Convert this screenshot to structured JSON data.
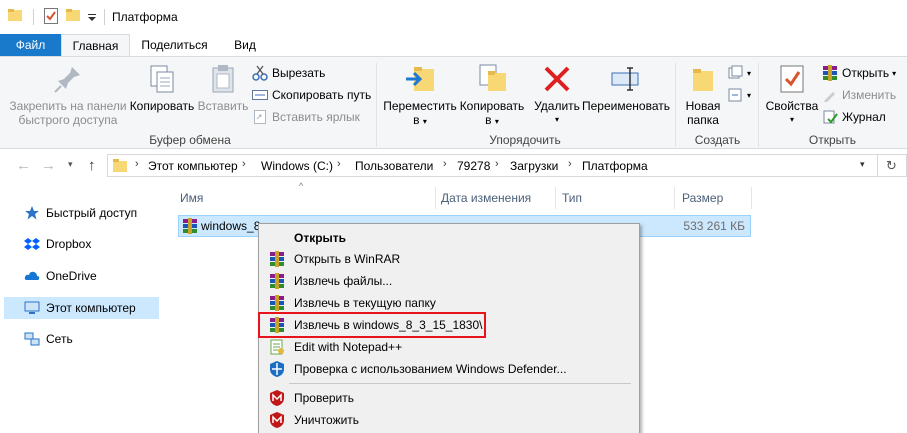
{
  "window": {
    "title": "Платформа"
  },
  "tabs": {
    "file": "Файл",
    "home": "Главная",
    "share": "Поделиться",
    "view": "Вид"
  },
  "ribbon": {
    "clipboard": {
      "pin": "Закрепить на панели быстрого доступа",
      "pin_line1": "Закрепить на панели",
      "pin_line2": "быстрого доступа",
      "copy": "Копировать",
      "paste": "Вставить",
      "cut": "Вырезать",
      "copy_path": "Скопировать путь",
      "paste_shortcut": "Вставить ярлык",
      "label": "Буфер обмена"
    },
    "organize": {
      "move_line1": "Переместить",
      "move_line2": "в",
      "copy_line1": "Копировать",
      "copy_line2": "в",
      "delete": "Удалить",
      "rename": "Переименовать",
      "label": "Упорядочить"
    },
    "new": {
      "folder_line1": "Новая",
      "folder_line2": "папка",
      "label": "Создать"
    },
    "open": {
      "properties": "Свойства",
      "open": "Открыть",
      "edit": "Изменить",
      "history": "Журнал",
      "label": "Открыть"
    }
  },
  "address": {
    "crumbs": [
      "Этот компьютер",
      "Windows (C:)",
      "Пользователи",
      "79278",
      "Загрузки",
      "Платформа"
    ]
  },
  "navpane": {
    "items": [
      {
        "label": "Быстрый доступ",
        "icon": "star-icon"
      },
      {
        "label": "Dropbox",
        "icon": "dropbox-icon"
      },
      {
        "label": "OneDrive",
        "icon": "cloud-icon"
      },
      {
        "label": "Этот компьютер",
        "icon": "computer-icon"
      },
      {
        "label": "Сеть",
        "icon": "network-icon"
      }
    ]
  },
  "filelist": {
    "columns": [
      "Имя",
      "Дата изменения",
      "Тип",
      "Размер"
    ],
    "rows": [
      {
        "name": "windows_8",
        "size": "533 261 КБ"
      }
    ]
  },
  "context_menu": {
    "items": [
      {
        "label": "Открыть",
        "icon": "none",
        "bold": true
      },
      {
        "label": "Открыть в WinRAR",
        "icon": "winrar-icon"
      },
      {
        "label": "Извлечь файлы...",
        "icon": "winrar-icon"
      },
      {
        "label": "Извлечь в текущую папку",
        "icon": "winrar-icon"
      },
      {
        "label": "Извлечь в windows_8_3_15_1830\\",
        "icon": "winrar-icon"
      },
      {
        "label": "Edit with Notepad++",
        "icon": "notepad-icon"
      },
      {
        "label": "Проверка с использованием Windows Defender...",
        "icon": "defender-icon"
      },
      {
        "label": "Проверить",
        "icon": "mcafee-icon"
      },
      {
        "label": "Уничтожить",
        "icon": "mcafee-icon"
      }
    ]
  },
  "colors": {
    "accent": "#1979ca",
    "selection": "#cce8ff",
    "highlight_box": "#e8141b"
  }
}
